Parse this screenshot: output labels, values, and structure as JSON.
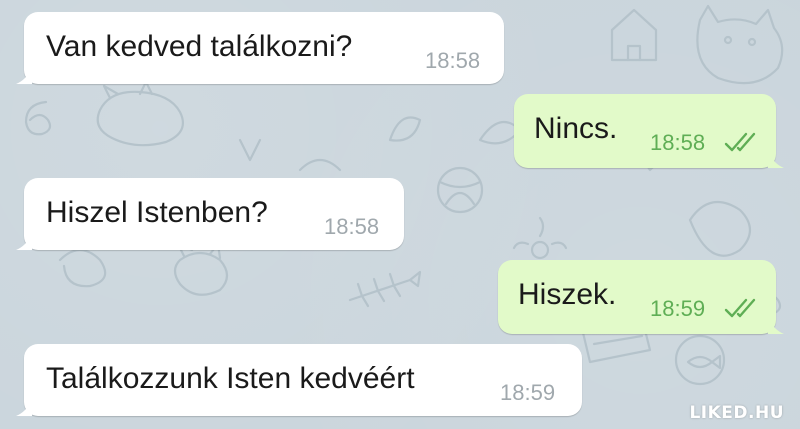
{
  "chat": {
    "messages": [
      {
        "direction": "incoming",
        "text": "Van kedved találkozni?",
        "time": "18:58"
      },
      {
        "direction": "outgoing",
        "text": "Nincs.",
        "time": "18:58",
        "status_icon": "double-check-icon"
      },
      {
        "direction": "incoming",
        "text": "Hiszel Istenben?",
        "time": "18:58"
      },
      {
        "direction": "outgoing",
        "text": "Hiszek.",
        "time": "18:59",
        "status_icon": "double-check-icon"
      },
      {
        "direction": "incoming",
        "text": "Találkozzunk Isten kedvéért",
        "time": "18:59"
      }
    ]
  },
  "watermark": "LIKED.HU",
  "colors": {
    "background": "#cad5dc",
    "incoming_bubble": "#ffffff",
    "outgoing_bubble": "#e2fac9",
    "outgoing_meta": "#5fae55",
    "incoming_meta": "#a0a8ad"
  }
}
